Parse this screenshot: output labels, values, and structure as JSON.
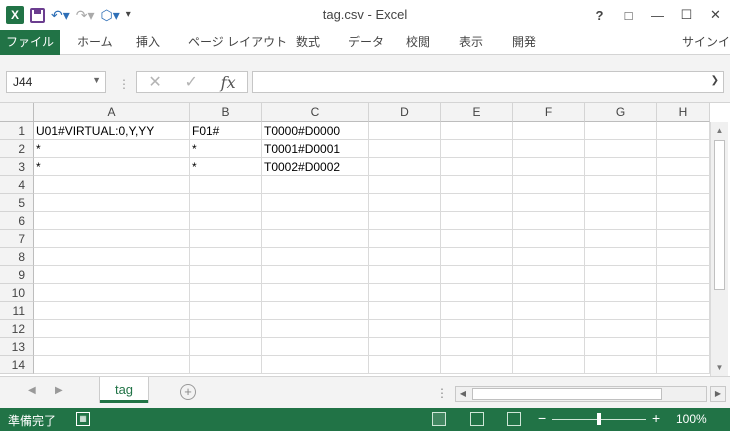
{
  "window": {
    "title": "tag.csv - Excel",
    "help": "?",
    "restore_ribbon": "□",
    "minimize": "—",
    "maximize": "☐",
    "close": "✕"
  },
  "qat": {
    "app_icon": "X",
    "icons": [
      "excel-logo-icon",
      "save-icon",
      "undo-icon",
      "redo-icon",
      "touch-mode-icon",
      "customize-icon"
    ]
  },
  "ribbon": {
    "file_tab": "ファイル",
    "tabs": [
      "ホーム",
      "挿入",
      "ページ レイアウト",
      "数式",
      "データ",
      "校閲",
      "表示",
      "開発"
    ],
    "signin": "サインイン"
  },
  "formula_bar": {
    "name_box": "J44",
    "formula": "",
    "fx": "fx"
  },
  "columns": [
    "A",
    "B",
    "C",
    "D",
    "E",
    "F",
    "G",
    "H"
  ],
  "rows": [
    "1",
    "2",
    "3",
    "4",
    "5",
    "6",
    "7",
    "8",
    "9",
    "10",
    "11",
    "12",
    "13",
    "14"
  ],
  "cells": [
    [
      "U01#VIRTUAL:0,Y,YY",
      "F01#",
      "T0000#D0000"
    ],
    [
      "*",
      "*",
      "T0001#D0001"
    ],
    [
      "*",
      "*",
      "T0002#D0002"
    ]
  ],
  "sheets": {
    "active": "tag",
    "add": "+"
  },
  "status": {
    "ready": "準備完了",
    "zoom": "100%",
    "zoom_minus": "−",
    "zoom_plus": "+"
  },
  "colors": {
    "accent": "#217346"
  }
}
